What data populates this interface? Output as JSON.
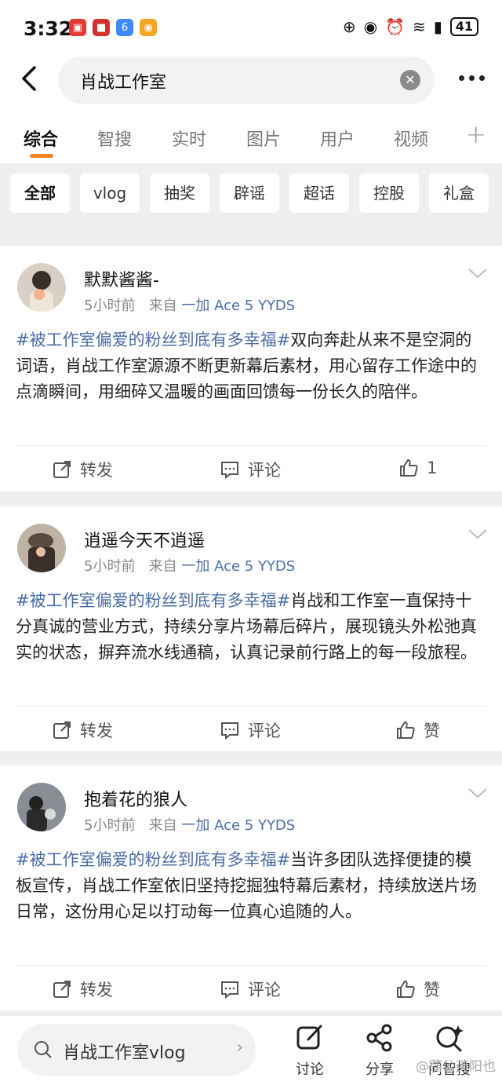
{
  "status_bar": {
    "time": "3:32",
    "battery": "41"
  },
  "search": {
    "query": "肖战工作室"
  },
  "tabs": [
    {
      "label": "综合"
    },
    {
      "label": "智搜"
    },
    {
      "label": "实时"
    },
    {
      "label": "图片"
    },
    {
      "label": "用户"
    },
    {
      "label": "视频"
    }
  ],
  "filter_chips": [
    {
      "label": "全部"
    },
    {
      "label": "vlog"
    },
    {
      "label": "抽奖"
    },
    {
      "label": "辟谣"
    },
    {
      "label": "超话"
    },
    {
      "label": "控股"
    },
    {
      "label": "礼盒"
    }
  ],
  "posts": [
    {
      "username": "默默酱酱-",
      "time": "5小时前",
      "source_prefix": "来自",
      "device": "一加 Ace 5 YYDS",
      "topic": "#被工作室偏爱的粉丝到底有多幸福#",
      "text": "双向奔赴从来不是空洞的词语，肖战工作室源源不断更新幕后素材，用心留存工作途中的点滴瞬间，用细碎又温暖的画面回馈每一份长久的陪伴。",
      "repost_label": "转发",
      "comment_label": "评论",
      "like_label": "1"
    },
    {
      "username": "逍遥今天不逍遥",
      "time": "5小时前",
      "source_prefix": "来自",
      "device": "一加 Ace 5 YYDS",
      "topic": "#被工作室偏爱的粉丝到底有多幸福#",
      "text": "肖战和工作室一直保持十分真诚的营业方式，持续分享片场幕后碎片，展现镜头外松弛真实的状态，摒弃流水线通稿，认真记录前行路上的每一段旅程。",
      "repost_label": "转发",
      "comment_label": "评论",
      "like_label": "赞"
    },
    {
      "username": "抱着花的狼人",
      "time": "5小时前",
      "source_prefix": "来自",
      "device": "一加 Ace 5 YYDS",
      "topic": "#被工作室偏爱的粉丝到底有多幸福#",
      "text": "当许多团队选择便捷的模板宣传，肖战工作室依旧坚持挖掘独特幕后素材，持续放送片场日常，这份用心足以打动每一位真心追随的人。",
      "repost_label": "转发",
      "comment_label": "评论",
      "like_label": "赞"
    }
  ],
  "bottom_bar": {
    "suggestion": "肖战工作室vlog",
    "discuss_label": "讨论",
    "share_label": "分享",
    "ask_label": "问智搜",
    "watermark": "@蒲公英阳也"
  }
}
